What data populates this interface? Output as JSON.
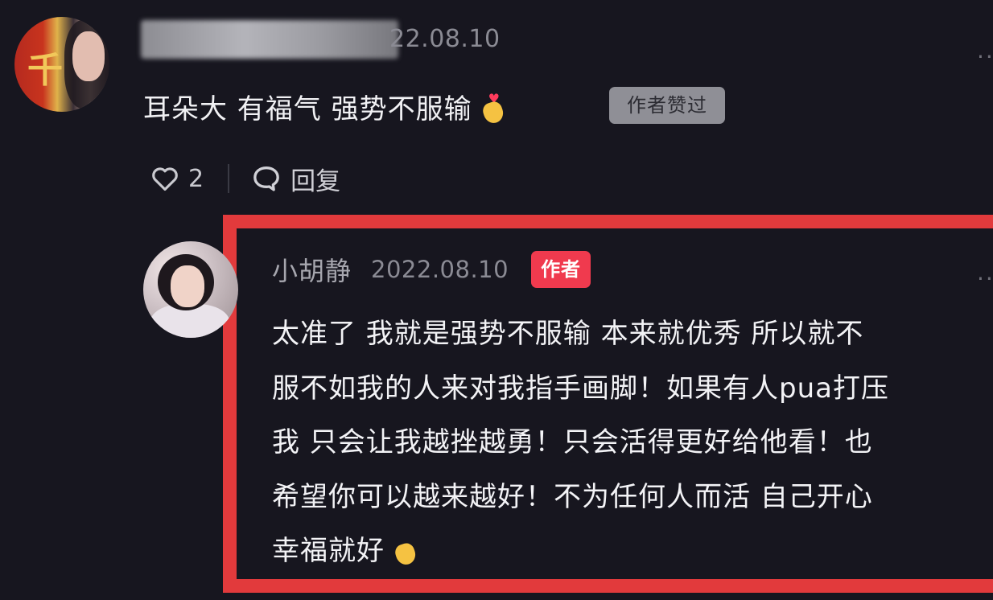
{
  "comment": {
    "date": "22.08.10",
    "text": "耳朵大 有福气 强势不服输",
    "text_emoji": "finger-heart-emoji",
    "liked_badge": "作者赞过",
    "like_count": "2",
    "reply_label": "回复"
  },
  "reply": {
    "author": "小胡静",
    "date": "2022.08.10",
    "author_badge": "作者",
    "lines": [
      "太准了 我就是强势不服输 本来就优秀 所以就不",
      "服不如我的人来对我指手画脚！如果有人pua打压",
      "我 只会让我越挫越勇！只会活得更好给他看！也",
      "希望你可以越来越好！不为任何人而活 自己开心",
      "幸福就好"
    ],
    "text_emoji": "finger-heart-emoji"
  },
  "icons": {
    "like": "heart-outline-icon",
    "reply": "chat-bubble-icon",
    "more": "more-dots-icon"
  },
  "colors": {
    "background": "#17161f",
    "highlight_border": "#e23a3c",
    "author_badge": "#f03a4e",
    "liked_badge": "#8f8f96"
  }
}
